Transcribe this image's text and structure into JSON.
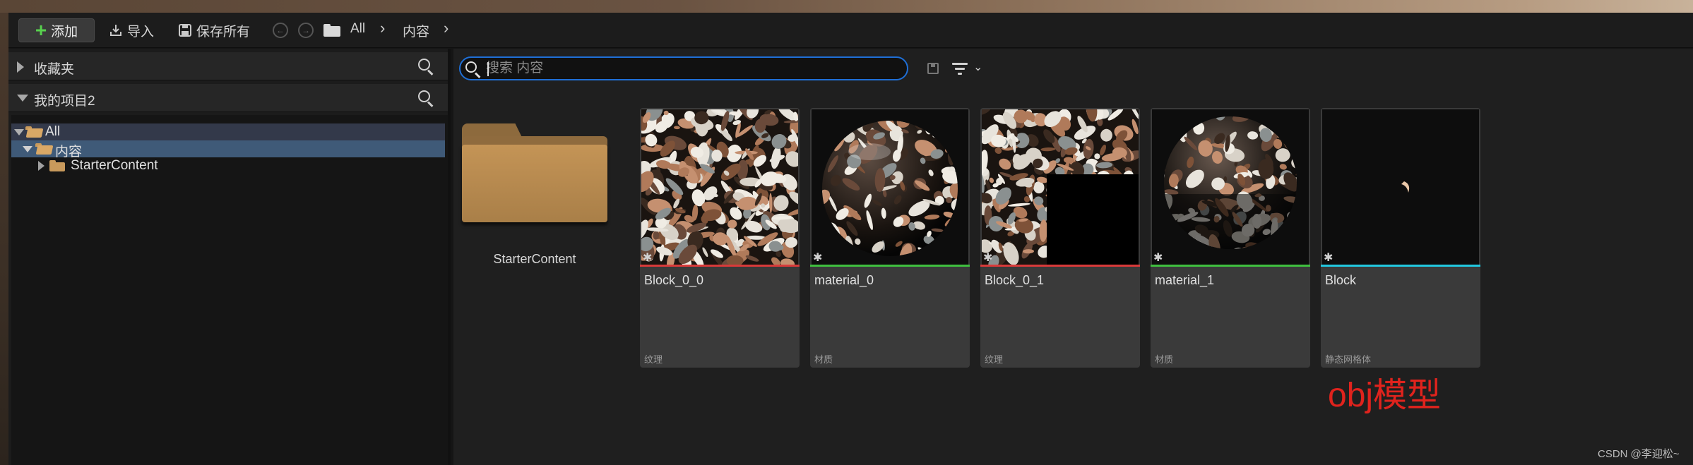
{
  "toolbar": {
    "add_label": "添加",
    "import_label": "导入",
    "save_all_label": "保存所有",
    "breadcrumbs": [
      "All",
      "内容"
    ]
  },
  "left_panel": {
    "favorites_label": "收藏夹",
    "project_label": "我的项目2",
    "tree": [
      {
        "label": "All",
        "expanded": true
      },
      {
        "label": "内容",
        "expanded": true,
        "selected": true
      },
      {
        "label": "StarterContent",
        "expanded": false
      }
    ]
  },
  "search": {
    "placeholder": "搜索 内容",
    "value": ""
  },
  "assets": {
    "folder": {
      "name": "StarterContent"
    },
    "tiles": [
      {
        "name": "Block_0_0",
        "type": "纹理",
        "bar_color": "#d93a3a",
        "kind": "texture"
      },
      {
        "name": "material_0",
        "type": "材质",
        "bar_color": "#3fbf3f",
        "kind": "sphere"
      },
      {
        "name": "Block_0_1",
        "type": "纹理",
        "bar_color": "#d93a3a",
        "kind": "texture2"
      },
      {
        "name": "material_1",
        "type": "材质",
        "bar_color": "#3fbf3f",
        "kind": "sphere2"
      },
      {
        "name": "Block",
        "type": "静态网格体",
        "bar_color": "#22c8e0",
        "kind": "mesh"
      }
    ]
  },
  "annotation": "obj模型",
  "watermark": "CSDN @李迎松~"
}
